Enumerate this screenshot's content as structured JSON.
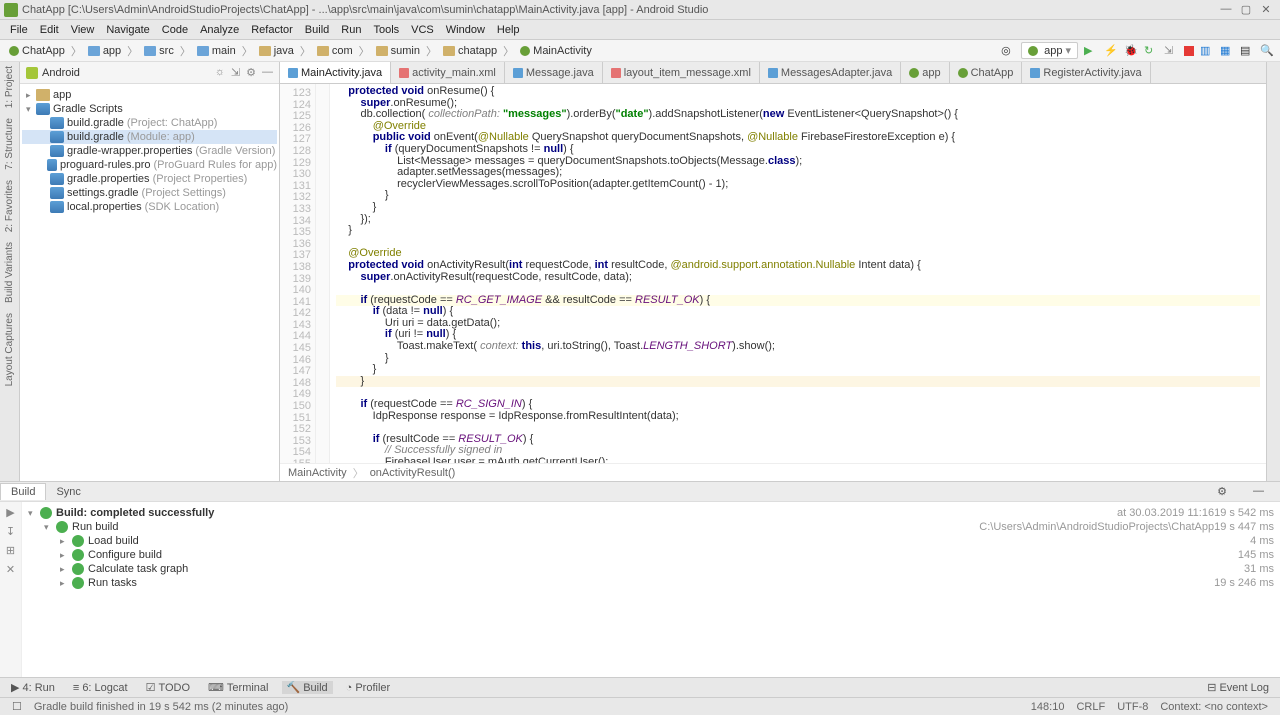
{
  "title": "ChatApp [C:\\Users\\Admin\\AndroidStudioProjects\\ChatApp] - ...\\app\\src\\main\\java\\com\\sumin\\chatapp\\MainActivity.java [app] - Android Studio",
  "menu": [
    "File",
    "Edit",
    "View",
    "Navigate",
    "Code",
    "Analyze",
    "Refactor",
    "Build",
    "Run",
    "Tools",
    "VCS",
    "Window",
    "Help"
  ],
  "breadcrumbs": [
    "ChatApp",
    "app",
    "src",
    "main",
    "java",
    "com",
    "sumin",
    "chatapp",
    "MainActivity"
  ],
  "run_config": "app",
  "project_panel": {
    "title": "Android",
    "tree": [
      {
        "depth": 0,
        "arrow": "▸",
        "icon": "folder",
        "label": "app"
      },
      {
        "depth": 0,
        "arrow": "▾",
        "icon": "gradle",
        "label": "Gradle Scripts"
      },
      {
        "depth": 1,
        "icon": "gradle",
        "label": "build.gradle",
        "hint": "(Project: ChatApp)"
      },
      {
        "depth": 1,
        "icon": "gradle",
        "label": "build.gradle",
        "hint": "(Module: app)",
        "selected": true
      },
      {
        "depth": 1,
        "icon": "gradle",
        "label": "gradle-wrapper.properties",
        "hint": "(Gradle Version)"
      },
      {
        "depth": 1,
        "icon": "gradle",
        "label": "proguard-rules.pro",
        "hint": "(ProGuard Rules for app)"
      },
      {
        "depth": 1,
        "icon": "gradle",
        "label": "gradle.properties",
        "hint": "(Project Properties)"
      },
      {
        "depth": 1,
        "icon": "gradle",
        "label": "settings.gradle",
        "hint": "(Project Settings)"
      },
      {
        "depth": 1,
        "icon": "gradle",
        "label": "local.properties",
        "hint": "(SDK Location)"
      }
    ]
  },
  "tabs": [
    {
      "label": "MainActivity.java",
      "icon": "java",
      "active": true
    },
    {
      "label": "activity_main.xml",
      "icon": "xml"
    },
    {
      "label": "Message.java",
      "icon": "java"
    },
    {
      "label": "layout_item_message.xml",
      "icon": "xml"
    },
    {
      "label": "MessagesAdapter.java",
      "icon": "java"
    },
    {
      "label": "app",
      "icon": "mod"
    },
    {
      "label": "ChatApp",
      "icon": "mod"
    },
    {
      "label": "RegisterActivity.java",
      "icon": "java"
    }
  ],
  "line_start": 123,
  "line_end": 155,
  "editor_breadcrumb": [
    "MainActivity",
    "onActivityResult()"
  ],
  "dock_tabs": {
    "left": [
      "Build",
      "Sync"
    ],
    "active": "Build"
  },
  "build": {
    "header": {
      "label": "Build: completed successfully",
      "hint": "at 30.03.2019 11:16",
      "time": "19 s 542 ms"
    },
    "rows": [
      {
        "indent": 1,
        "arrow": "▾",
        "label": "Run build",
        "hint": "C:\\Users\\Admin\\AndroidStudioProjects\\ChatApp",
        "time": "19 s 447 ms"
      },
      {
        "indent": 2,
        "arrow": "▸",
        "label": "Load build",
        "time": "4 ms"
      },
      {
        "indent": 2,
        "arrow": "▸",
        "label": "Configure build",
        "time": "145 ms"
      },
      {
        "indent": 2,
        "arrow": "▸",
        "label": "Calculate task graph",
        "time": "31 ms"
      },
      {
        "indent": 2,
        "arrow": "▸",
        "label": "Run tasks",
        "time": "19 s 246 ms"
      }
    ]
  },
  "tool_tabs": [
    {
      "label": "4: Run",
      "icon": "▶"
    },
    {
      "label": "6: Logcat",
      "icon": "≡"
    },
    {
      "label": "TODO",
      "icon": "☑"
    },
    {
      "label": "Terminal",
      "icon": "⌨"
    },
    {
      "label": "Build",
      "icon": "🔨",
      "active": true
    },
    {
      "label": "Profiler",
      "icon": "◔"
    }
  ],
  "event_log": "Event Log",
  "status": {
    "msg": "Gradle build finished in 19 s 542 ms (2 minutes ago)",
    "pos": "148:10",
    "eol": "CRLF",
    "enc": "UTF-8",
    "context": "Context: <no context>"
  },
  "left_tools": [
    "1: Project",
    "7: Structure",
    "2: Favorites",
    "Build Variants",
    "Layout Captures"
  ]
}
